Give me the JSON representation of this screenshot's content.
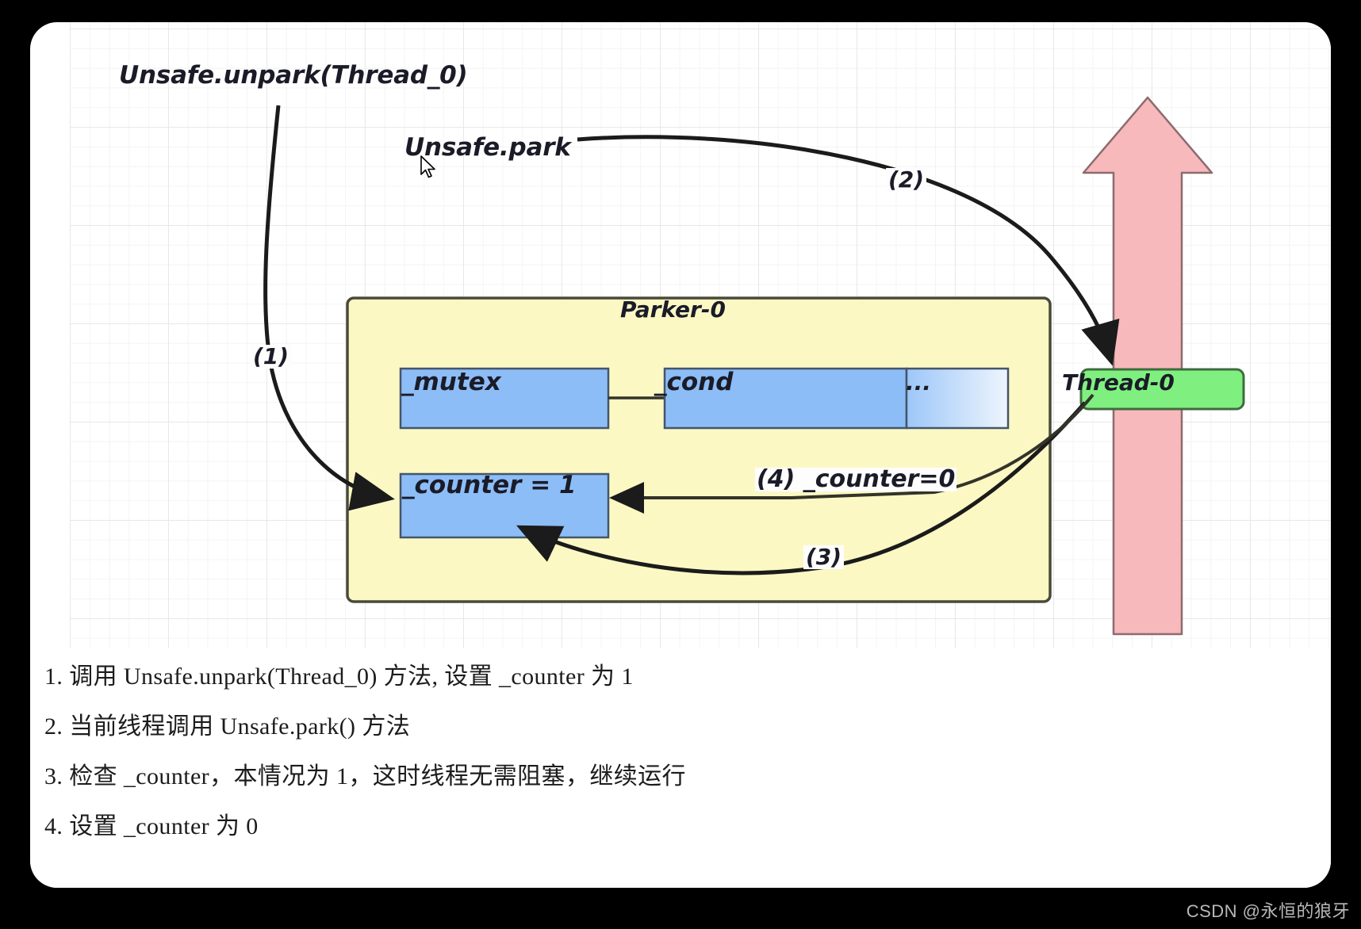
{
  "diagram": {
    "title_unpark": "Unsafe.unpark(Thread_0)",
    "title_park": "Unsafe.park",
    "parker_label": "Parker-0",
    "fields": {
      "mutex": "_mutex",
      "cond": "_cond",
      "ellipsis": "...",
      "counter": "_counter = 1"
    },
    "thread_label": "Thread-0",
    "steps": {
      "s1": "(1)",
      "s2": "(2)",
      "s3": "(3)",
      "s4": "(4) _counter=0"
    },
    "colors": {
      "parker_fill": "#fbf8c4",
      "parker_stroke": "#6b6b4b",
      "field_fill": "#8cbdf7",
      "field_stroke": "#44556b",
      "thread_fill": "#7ff07f",
      "thread_stroke": "#3f6b3f",
      "big_arrow_fill": "#f7b9bc",
      "big_arrow_stroke": "#8d6b6e",
      "connector": "#1b1b1b",
      "page_bg": "#ffffff",
      "frame_bg": "#000000",
      "grid_line": "#e8e8e8"
    }
  },
  "notes": [
    "1. 调用 Unsafe.unpark(Thread_0) 方法, 设置 _counter 为 1",
    "2. 当前线程调用 Unsafe.park() 方法",
    "3. 检查 _counter，本情况为 1，这时线程无需阻塞，继续运行",
    "4. 设置 _counter 为 0"
  ],
  "watermark": "CSDN @永恒的狼牙"
}
